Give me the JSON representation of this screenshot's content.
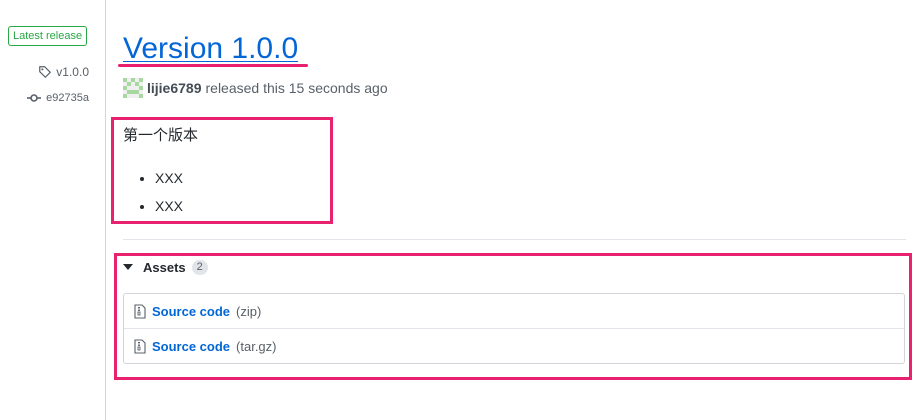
{
  "sidebar": {
    "badge": "Latest release",
    "tag": "v1.0.0",
    "commit": "e92735a"
  },
  "release": {
    "title": "Version 1.0.0",
    "author": "lijie6789",
    "released_text": "released this 15 seconds ago",
    "notes_heading": "第一个版本",
    "notes_items": [
      "XXX",
      "XXX"
    ]
  },
  "assets": {
    "label": "Assets",
    "count": "2",
    "items": [
      {
        "name": "Source code",
        "ext": "(zip)"
      },
      {
        "name": "Source code",
        "ext": "(tar.gz)"
      }
    ]
  },
  "colors": {
    "link": "#0366d6",
    "badge_green": "#28a745",
    "highlight": "#e8226f"
  }
}
